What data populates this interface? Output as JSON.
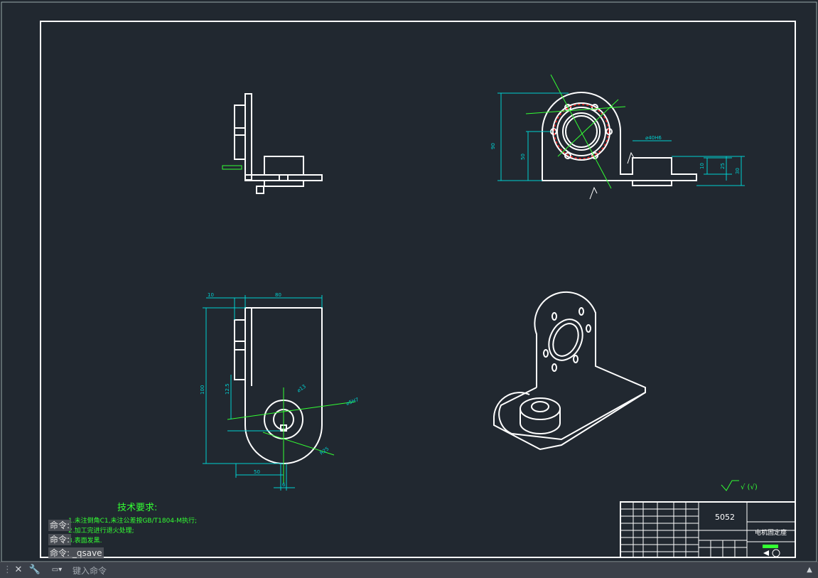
{
  "drawing": {
    "tech_requirements_title": "技术要求:",
    "tech_requirements": [
      "1.未注倒角C1,未注公差按GB/T1804-M执行;",
      "2.加工完进行退火处理;",
      "3.表面发黑."
    ],
    "dimensions": {
      "top_left": [
        "10",
        "80"
      ],
      "left_vertical": [
        "100",
        "12.5"
      ],
      "bottom": [
        "50",
        "6"
      ],
      "front_view": [
        "90",
        "50",
        "10",
        "25",
        "30"
      ],
      "front_hole": "⌀40H6",
      "labels_misc": [
        "⌀13",
        "R25",
        "⌀5H7",
        "8.6"
      ]
    },
    "surface_finish": "√ (√)",
    "title_block": {
      "material": "5052",
      "part_name": "电机固定座"
    }
  },
  "command": {
    "history": [
      "命令:",
      "命令:",
      "命令: _qsave"
    ],
    "input_placeholder": "键入命令"
  },
  "colors": {
    "background": "#212830",
    "lines": "#ffffff",
    "dimensions": "#00d0d0",
    "annotations": "#33ff33",
    "highlight": "#ff2020"
  }
}
